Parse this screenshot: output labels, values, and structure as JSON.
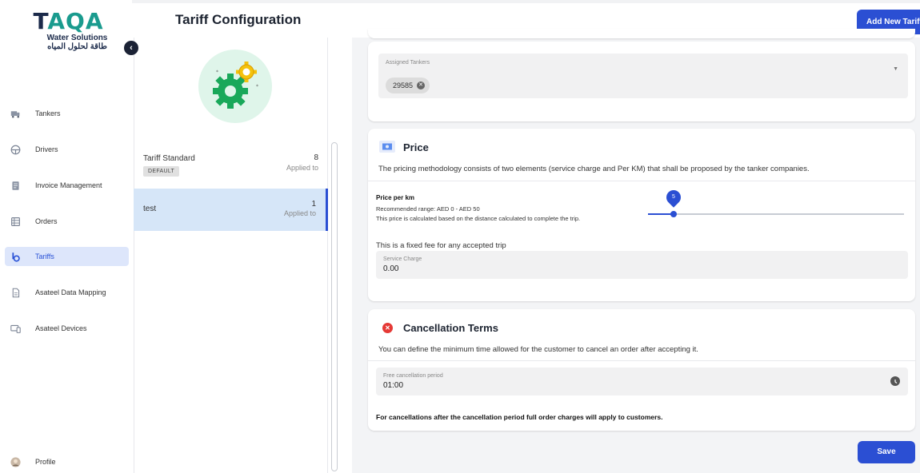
{
  "brand": {
    "logo_text_a": "T",
    "logo_text_b": "AQA",
    "subtitle": "Water Solutions",
    "subtitle_ar": "طاقة لحلول المياه"
  },
  "header": {
    "title": "Tariff Configuration",
    "add_button": "Add New Tariff"
  },
  "sidebar": {
    "collapse_icon": "chevron-left",
    "items": [
      {
        "label": "Tankers",
        "icon": "truck-icon"
      },
      {
        "label": "Drivers",
        "icon": "steering-wheel-icon"
      },
      {
        "label": "Invoice Management",
        "icon": "invoice-icon"
      },
      {
        "label": "Orders",
        "icon": "orders-icon"
      },
      {
        "label": "Tariffs",
        "icon": "tariffs-icon",
        "active": true
      },
      {
        "label": "Asateel Data Mapping",
        "icon": "document-icon"
      },
      {
        "label": "Asateel Devices",
        "icon": "devices-icon"
      }
    ],
    "profile": "Profile"
  },
  "tariffs": [
    {
      "name": "Tariff Standard",
      "badge": "DEFAULT",
      "count": "8",
      "applied": "Applied to"
    },
    {
      "name": "test",
      "count": "1",
      "applied": "Applied to",
      "selected": true
    }
  ],
  "assigned": {
    "label": "Assigned Tankers",
    "chips": [
      "29585"
    ]
  },
  "price": {
    "title": "Price",
    "description": "The pricing methodology consists of two elements (service charge and Per KM) that shall be proposed by the tanker companies.",
    "per_km_label": "Price per km",
    "range": "Recommended range: AED 0 - AED 50",
    "note": "This price is calculated based on the distance calculated to complete the trip.",
    "slider_value": "5",
    "slider_fraction": 0.1,
    "fixed_fee_text": "This is a fixed fee for any accepted trip",
    "service_label": "Service Charge",
    "service_value": "0.00"
  },
  "cancellation": {
    "title": "Cancellation Terms",
    "description": "You can define the minimum time allowed for the customer to cancel an order after accepting it.",
    "period_label": "Free cancellation period",
    "period_value": "01:00",
    "footer": "For cancellations after the cancellation period full order charges will apply to customers."
  },
  "actions": {
    "save": "Save"
  },
  "colors": {
    "primary": "#2b4fd3",
    "active_bg": "#dde6fb",
    "selected_row": "#d6e6f8",
    "danger": "#e53935",
    "gear_green": "#19a85a",
    "gear_yellow": "#f4c20d"
  }
}
